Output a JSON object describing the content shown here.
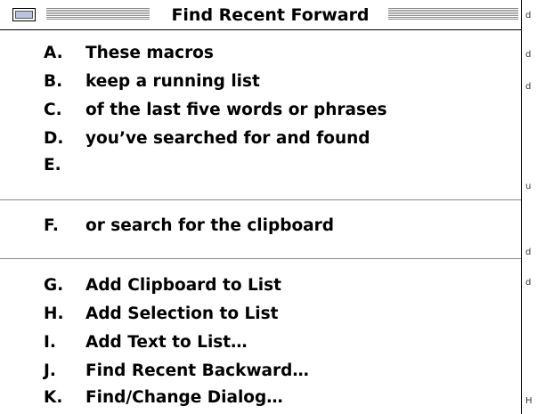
{
  "window": {
    "title": "Find Recent Forward"
  },
  "menu": {
    "group1": [
      {
        "key": "A.",
        "label": "These macros"
      },
      {
        "key": "B.",
        "label": "keep a running list"
      },
      {
        "key": "C.",
        "label": "of the last five words or phrases"
      },
      {
        "key": "D.",
        "label": "you’ve searched for and found"
      },
      {
        "key": "E.",
        "label": ""
      }
    ],
    "group2": [
      {
        "key": "F.",
        "label": "or search for the clipboard"
      }
    ],
    "group3": [
      {
        "key": "G.",
        "label": "Add Clipboard to List"
      },
      {
        "key": "H.",
        "label": "Add Selection to List"
      },
      {
        "key": "I.",
        "label": "Add Text to List…"
      },
      {
        "key": "J.",
        "label": "Find Recent Backward…"
      },
      {
        "key": "K.",
        "label": "Find/Change Dialog…"
      }
    ]
  },
  "background_marks": [
    "d",
    "d",
    "d",
    "u",
    "d",
    "d",
    "H"
  ],
  "colors": {
    "stripe": "#8a8a8a",
    "close_box_fill": "#b8c4e0"
  }
}
